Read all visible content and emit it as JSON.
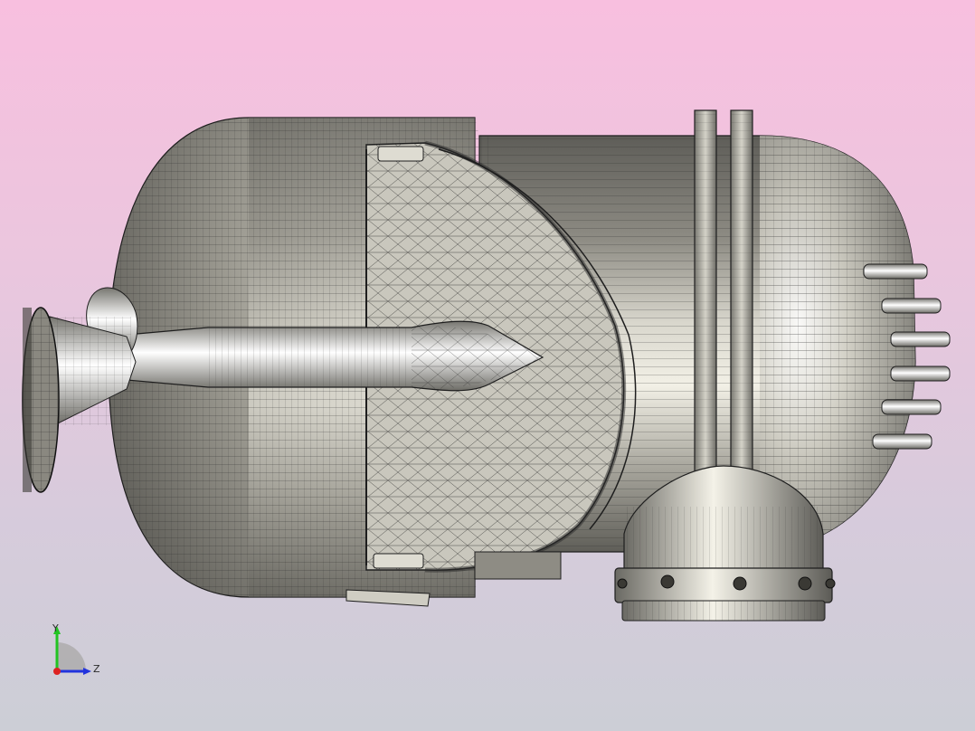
{
  "viewport": {
    "background_top": "#f8bfdf",
    "background_bottom": "#ccced6",
    "model_color": "#bdbbb2",
    "mesh_color": "#2a2a2a"
  },
  "triad": {
    "y_label": "Y",
    "z_label": "Z",
    "y_color": "#22c422",
    "z_color": "#2233dd",
    "x_color": "#dd2222"
  }
}
